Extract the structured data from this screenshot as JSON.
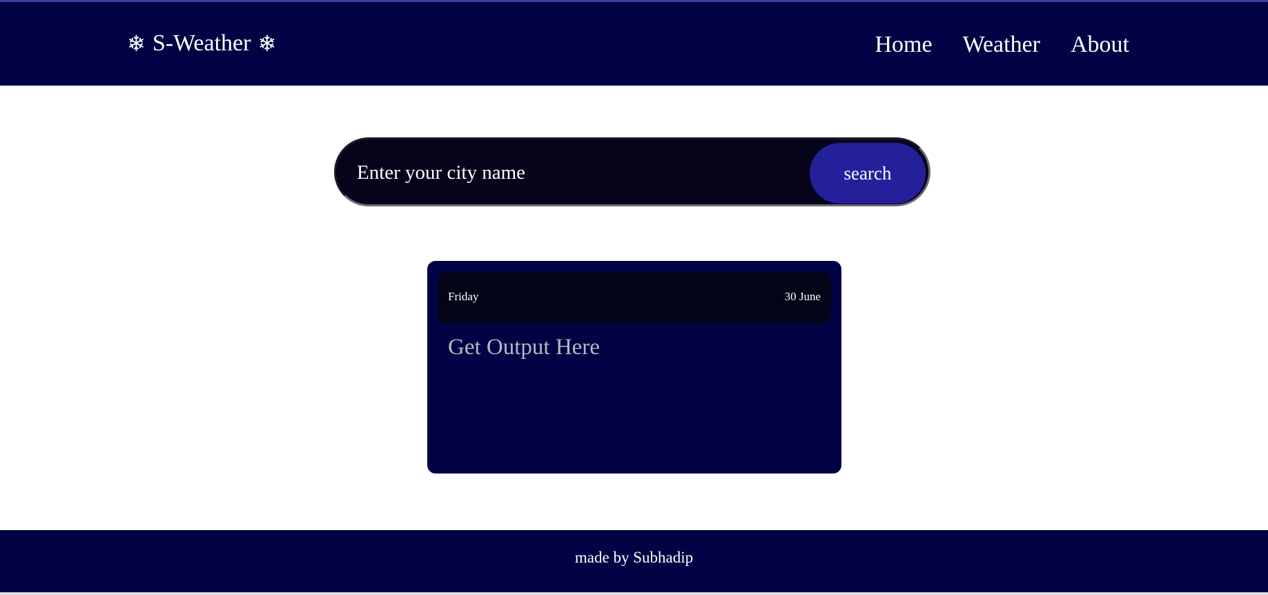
{
  "header": {
    "brand_icon_left": "❄",
    "brand_title": "S-Weather",
    "brand_icon_right": "❄",
    "nav": [
      {
        "label": "Home"
      },
      {
        "label": "Weather"
      },
      {
        "label": "About"
      }
    ]
  },
  "search": {
    "placeholder": "Enter your city name",
    "value": "",
    "button_label": "search"
  },
  "card": {
    "day": "Friday",
    "date": "30 June",
    "output": "Get Output Here"
  },
  "footer": {
    "text": "made by Subhadip"
  },
  "colors": {
    "navy": "#020344",
    "button": "#24209c",
    "input_bg": "#05041a"
  },
  "icons": {
    "brand": "snowflake-icon"
  }
}
